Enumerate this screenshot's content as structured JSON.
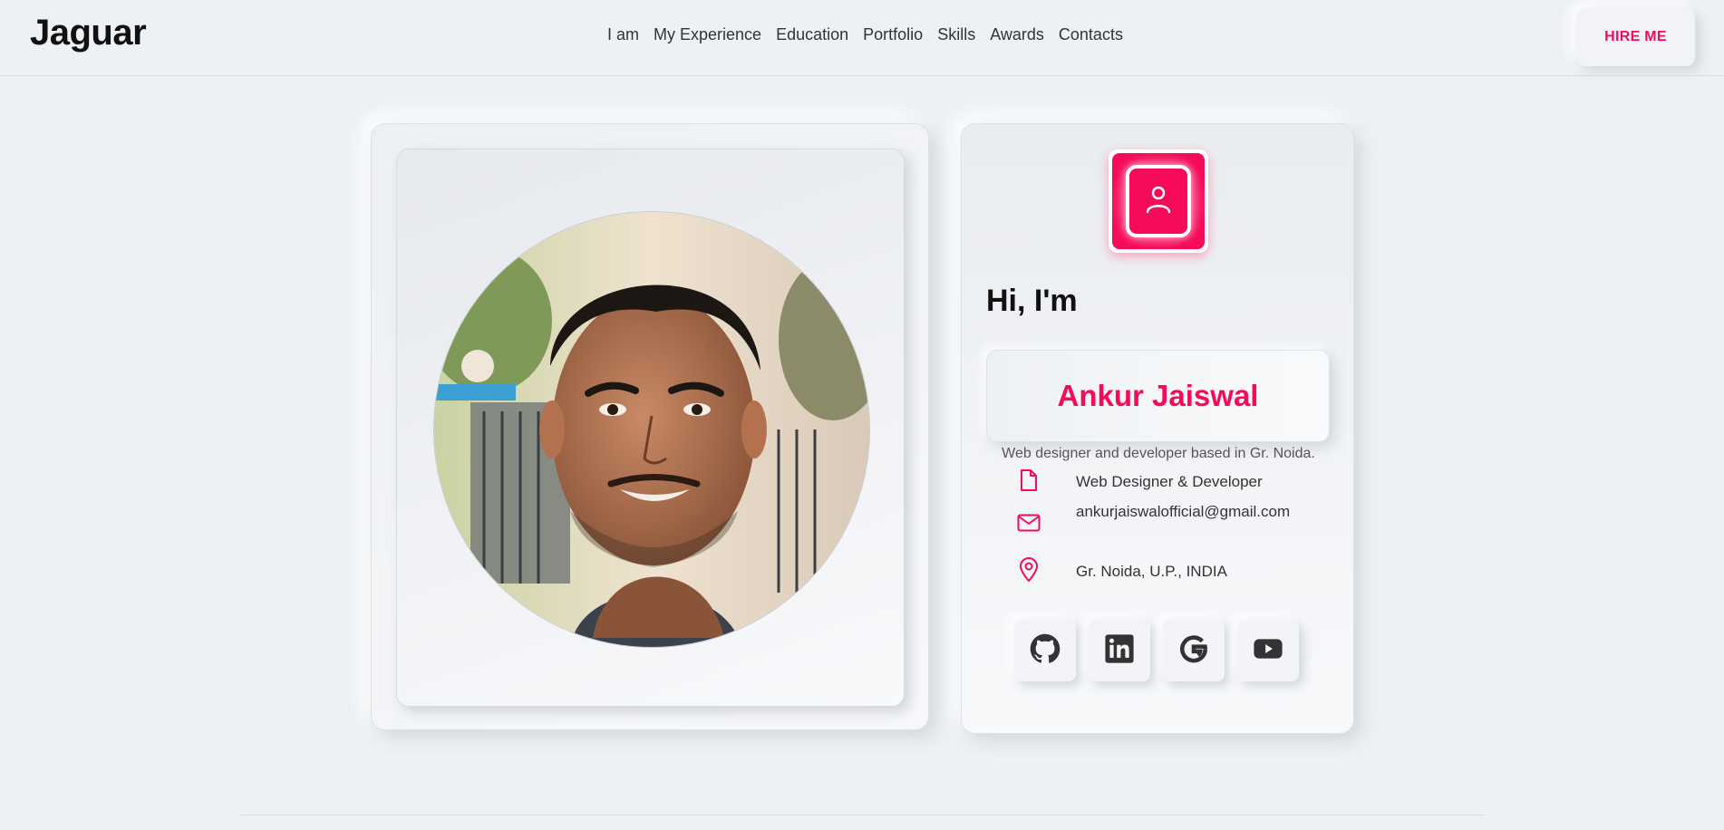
{
  "header": {
    "brand": "Jaguar",
    "nav": [
      "I am",
      "My Experience",
      "Education",
      "Portfolio",
      "Skills",
      "Awards",
      "Contacts"
    ],
    "hire_label": "HIRE ME"
  },
  "profile": {
    "avatar_icon": "user-icon",
    "greeting": "Hi, I'm",
    "name": "Ankur Jaiswal",
    "tagline": "Web designer and developer based in Gr. Noida.",
    "role": "Web Designer & Developer",
    "email": "ankurjaiswalofficial@gmail.com",
    "location": "Gr. Noida, U.P., INDIA"
  },
  "socials": [
    {
      "icon": "github-icon"
    },
    {
      "icon": "linkedin-icon"
    },
    {
      "icon": "google-icon"
    },
    {
      "icon": "youtube-icon"
    }
  ],
  "colors": {
    "accent": "#f50b59",
    "background": "#eef1f4"
  }
}
